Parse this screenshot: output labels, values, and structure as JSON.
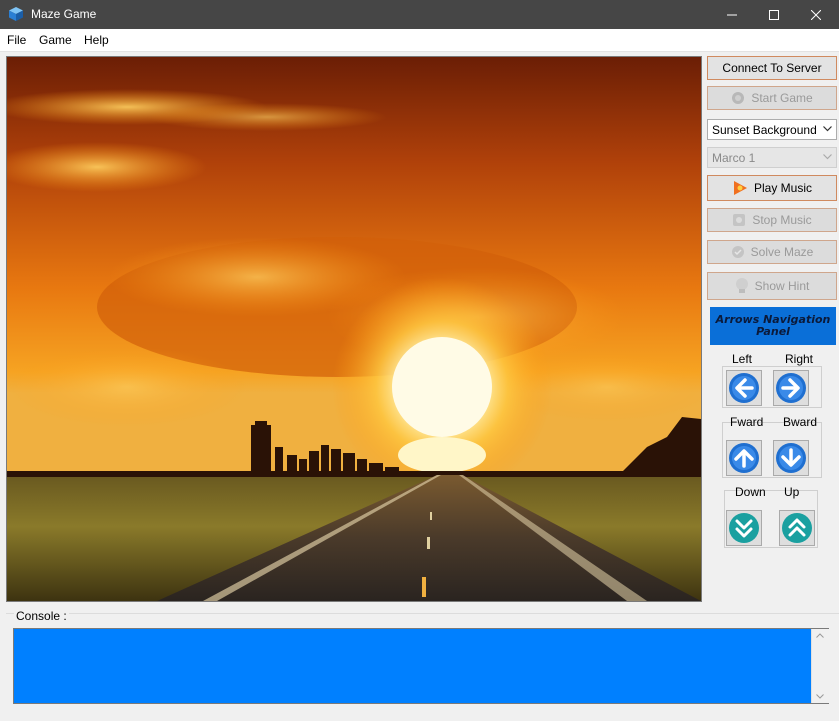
{
  "window": {
    "title": "Maze Game",
    "icons": {
      "app": "cube-icon",
      "minimize": "minimize-icon",
      "maximize": "maximize-icon",
      "close": "close-icon"
    }
  },
  "menu": {
    "items": [
      {
        "label": "File"
      },
      {
        "label": "Game"
      },
      {
        "label": "Help"
      }
    ]
  },
  "sidebar": {
    "connect_label": "Connect To Server",
    "start_label": "Start Game",
    "background_select": {
      "selected": "Sunset Background"
    },
    "maze_select": {
      "selected": "Marco 1"
    },
    "play_music_label": "Play Music",
    "stop_music_label": "Stop Music",
    "solve_label": "Solve Maze",
    "hint_label": "Show Hint"
  },
  "navigation": {
    "title_line1": "Arrows Navigation",
    "title_line2": "Panel",
    "left_label": "Left",
    "right_label": "Right",
    "forward_label": "Fward",
    "backward_label": "Bward",
    "down_label": "Down",
    "up_label": "Up"
  },
  "console": {
    "label": "Console :",
    "text": ""
  },
  "colors": {
    "titlebar": "#464646",
    "console_bg": "#0080ff",
    "nav_panel_bg": "#0a6fd8",
    "arrow_blue": "#1f6fd0",
    "arrow_teal": "#1aa0a0"
  }
}
